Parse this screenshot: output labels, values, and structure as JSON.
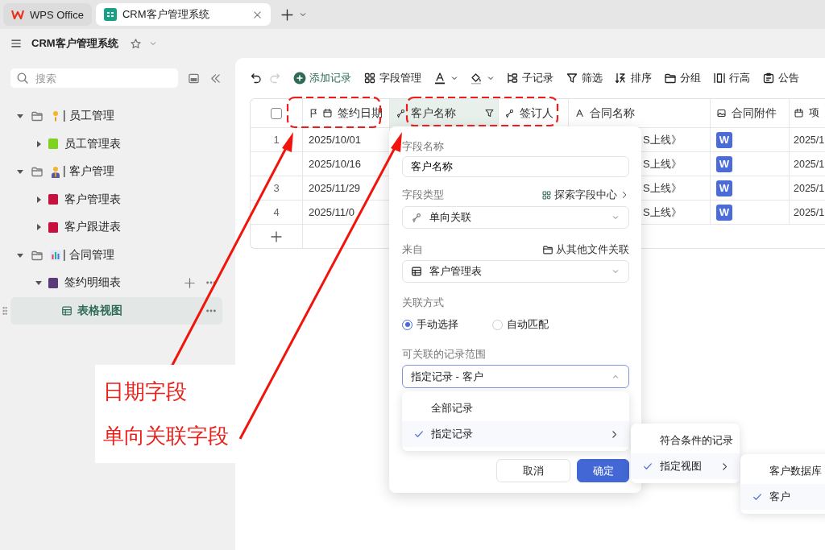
{
  "tabs": [
    {
      "label": "WPS Office",
      "kind": "home",
      "selected": false
    },
    {
      "label": "CRM客户管理系统",
      "kind": "doc",
      "selected": true
    }
  ],
  "title_bar": {
    "title": "CRM客户管理系统",
    "starred": false
  },
  "sidebar": {
    "search": {
      "placeholder": "搜索"
    },
    "tree": [
      {
        "label": "| 员工管理",
        "kind": "folder",
        "expanded": true,
        "selected": false,
        "children": [
          {
            "label": "员工管理表",
            "kind": "sheet",
            "color": "#7ed321",
            "expanded": false,
            "selected": false
          }
        ]
      },
      {
        "label": "| 客户管理",
        "kind": "folder",
        "expanded": true,
        "selected": false,
        "children": [
          {
            "label": "客户管理表",
            "kind": "sheet",
            "color": "#c8103e",
            "expanded": false,
            "selected": false
          },
          {
            "label": "客户跟进表",
            "kind": "sheet",
            "color": "#c8103e",
            "expanded": false,
            "selected": false
          }
        ]
      },
      {
        "label": "| 合同管理",
        "kind": "folder",
        "expanded": true,
        "selected": false,
        "children": [
          {
            "label": "签约明细表",
            "kind": "sheet",
            "color": "#5b3a7a",
            "expanded": true,
            "selected": false,
            "children": [
              {
                "label": "表格视图",
                "kind": "view",
                "selected": true
              }
            ]
          }
        ]
      }
    ]
  },
  "toolbar": {
    "items": [
      {
        "kind": "undo",
        "disabled": false
      },
      {
        "kind": "redo",
        "disabled": true
      },
      {
        "kind": "add",
        "label": "添加记录"
      },
      {
        "kind": "fields",
        "label": "字段管理"
      },
      {
        "kind": "text_color"
      },
      {
        "kind": "fill_color"
      },
      {
        "kind": "subrecord",
        "label": "子记录"
      },
      {
        "kind": "filter",
        "label": "筛选"
      },
      {
        "kind": "sort",
        "label": "排序"
      },
      {
        "kind": "group",
        "label": "分组"
      },
      {
        "kind": "row_height",
        "label": "行高"
      },
      {
        "kind": "notice",
        "label": "公告"
      }
    ]
  },
  "table": {
    "select_all_checked": false,
    "columns": [
      {
        "label": "签约日期",
        "kind": "date",
        "primary": true,
        "selected": false,
        "filtered": false
      },
      {
        "label": "客户名称",
        "kind": "link",
        "primary": false,
        "selected": true,
        "filtered": true
      },
      {
        "label": "签订人",
        "kind": "link",
        "primary": false,
        "selected": false,
        "filtered": false
      },
      {
        "label": "合同名称",
        "kind": "text",
        "primary": false,
        "selected": false,
        "filtered": false
      },
      {
        "label": "合同附件",
        "kind": "attachment",
        "primary": false,
        "selected": false,
        "filtered": false
      },
      {
        "label": "项",
        "kind": "date",
        "primary": false,
        "selected": false,
        "filtered": false
      }
    ],
    "rows": [
      {
        "number": "1",
        "date": "2025/10/01",
        "contract": "S上线》",
        "attachment": "W",
        "project": "2025/1"
      },
      {
        "date": "2025/10/16",
        "contract": "S上线》",
        "attachment": "W",
        "project": "2025/1"
      },
      {
        "number": "3",
        "date": "2025/11/29",
        "contract": "S上线》",
        "attachment": "W",
        "project": "2025/1"
      },
      {
        "number": "4",
        "date": "2025/11/0",
        "contract": "S上线》",
        "attachment": "W",
        "project": "2025/1"
      }
    ]
  },
  "field_dialog": {
    "name_label": "字段名称",
    "name_value": "客户名称",
    "type_label": "字段类型",
    "type_link": "探索字段中心",
    "type_value": "单向关联",
    "source_label": "来自",
    "source_link": "从其他文件关联",
    "source_value": "客户管理表",
    "mode_label": "关联方式",
    "modes": [
      {
        "label": "手动选择",
        "selected": true
      },
      {
        "label": "自动匹配",
        "selected": false
      }
    ],
    "range_label": "可关联的记录范围",
    "range_value": "指定记录 - 客户",
    "range_expanded": true,
    "range_options": [
      {
        "label": "全部记录",
        "selected": false
      },
      {
        "label": "指定记录",
        "selected": true,
        "children": [
          {
            "label": "符合条件的记录",
            "selected": false
          },
          {
            "label": "指定视图",
            "selected": true,
            "children": [
              {
                "label": "客户数据库",
                "selected": false
              },
              {
                "label": "客户",
                "selected": true
              }
            ]
          }
        ]
      }
    ],
    "buttons": [
      {
        "label": "取消",
        "kind": "secondary"
      },
      {
        "label": "确定",
        "kind": "primary"
      }
    ]
  },
  "annotations": {
    "labels": [
      "日期字段",
      "单向关联字段"
    ]
  }
}
